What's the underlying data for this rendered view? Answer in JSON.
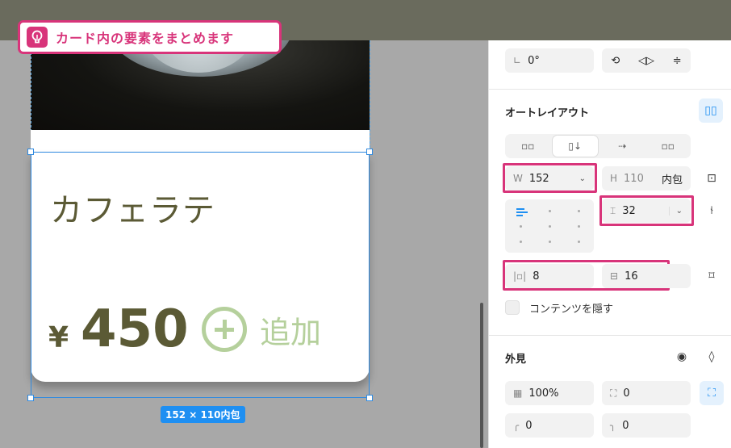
{
  "tip": {
    "text": "カード内の要素をまとめます"
  },
  "card": {
    "title": "カフェラテ",
    "price_symbol": "¥",
    "price": "450",
    "add_label": "追加"
  },
  "selection": {
    "size_label": "152 × 110内包"
  },
  "panel": {
    "rotation": {
      "value": "0°"
    },
    "autolayout": {
      "title": "オートレイアウト"
    },
    "width": {
      "label": "W",
      "value": "152"
    },
    "height": {
      "label": "H",
      "value": "110",
      "mode": "内包"
    },
    "gap": {
      "value": "32"
    },
    "padding_h": {
      "value": "8"
    },
    "padding_v": {
      "value": "16"
    },
    "clip_content": {
      "label": "コンテンツを隠す"
    },
    "appearance": {
      "title": "外見"
    },
    "opacity": {
      "value": "100%"
    },
    "corner_all": {
      "value": "0"
    },
    "corner_tl": {
      "value": "0"
    },
    "corner_tr": {
      "value": "0"
    }
  },
  "colors": {
    "accent": "#d8347a",
    "selection": "#1e8ff2",
    "card_text": "#5b5a35",
    "add_green": "#b5d09c"
  }
}
